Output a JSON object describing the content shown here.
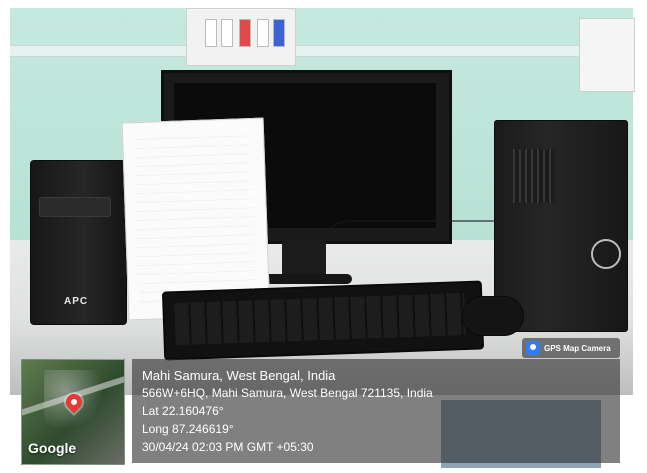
{
  "gps": {
    "app_badge": "GPS Map Camera",
    "place": "Mahi Samura, West Bengal, India",
    "address": "566W+6HQ, Mahi Samura, West Bengal 721135, India",
    "lat": "Lat 22.160476°",
    "long": "Long 87.246619°",
    "datetime": "30/04/24 02:03 PM GMT +05:30"
  },
  "map": {
    "brand": "Google"
  },
  "objects": {
    "ups_brand": "APC"
  },
  "colors": {
    "overlay_bg": "rgba(50,50,50,0.62)",
    "pin": "#e53935",
    "gps_icon": "#2f7cf6"
  },
  "icons": {
    "gps_badge_icon": "camera-icon",
    "map_marker_icon": "location-pin-icon"
  }
}
